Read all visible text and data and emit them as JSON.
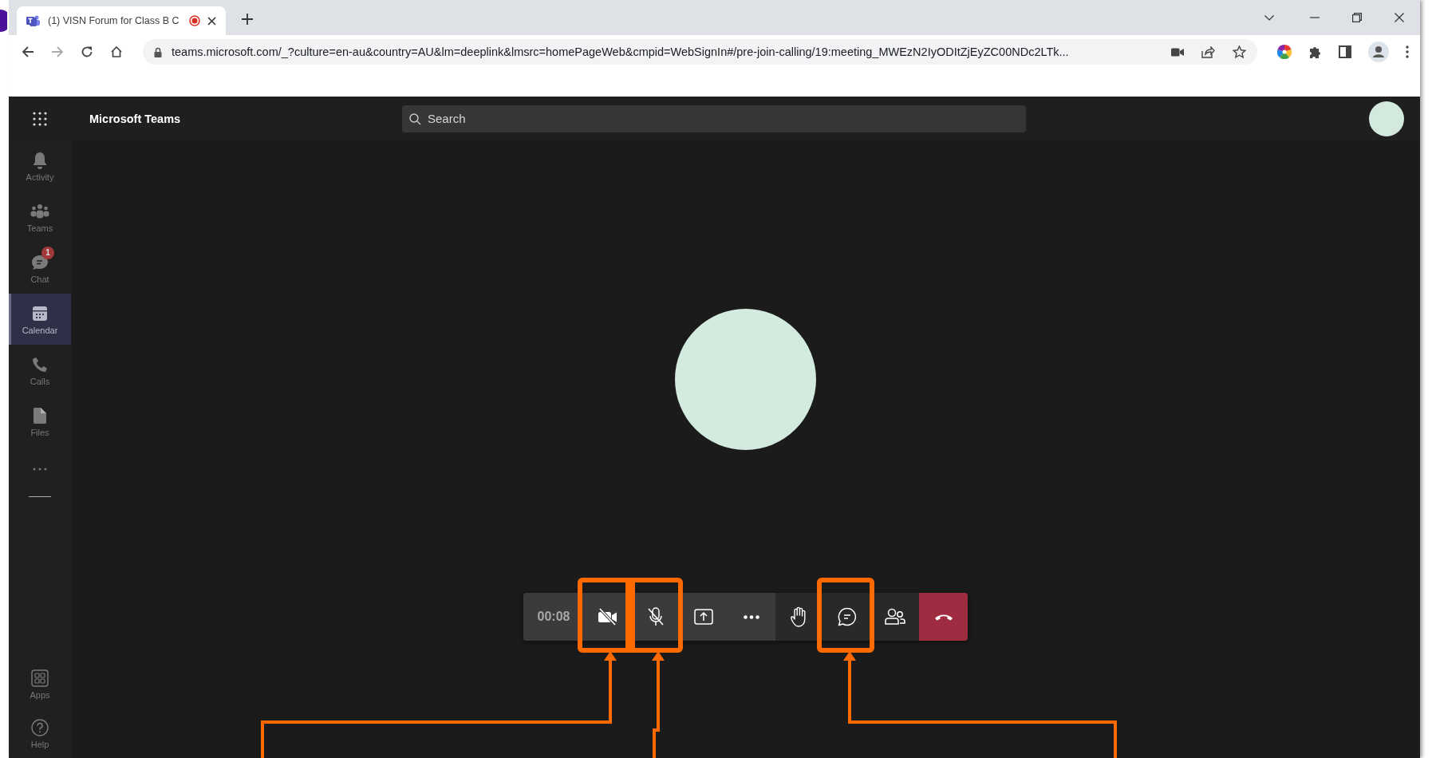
{
  "browser": {
    "tab": {
      "title": "(1) VISN Forum for Class B C",
      "recording": true
    },
    "address": "teams.microsoft.com/_?culture=en-au&country=AU&lm=deeplink&lmsrc=homePageWeb&cmpid=WebSignIn#/pre-join-calling/19:meeting_MWEzN2IyODItZjEyZC00NDc2LTk..."
  },
  "app": {
    "title": "Microsoft Teams",
    "search": {
      "placeholder": "Search"
    }
  },
  "sidebar": {
    "items": [
      {
        "kind": "activity",
        "label": "Activity",
        "selected": false
      },
      {
        "kind": "teams",
        "label": "Teams",
        "selected": false
      },
      {
        "kind": "chat",
        "label": "Chat",
        "selected": false,
        "badge": "1"
      },
      {
        "kind": "calendar",
        "label": "Calendar",
        "selected": true
      },
      {
        "kind": "calls",
        "label": "Calls",
        "selected": false
      },
      {
        "kind": "files",
        "label": "Files",
        "selected": false
      }
    ],
    "bottom_items": [
      {
        "kind": "apps",
        "label": "Apps",
        "selected": false
      },
      {
        "kind": "help",
        "label": "Help",
        "selected": false
      }
    ]
  },
  "call": {
    "timer": "00:08",
    "controls": [
      {
        "kind": "camera",
        "off": true,
        "highlighted": true
      },
      {
        "kind": "mic",
        "off": true,
        "highlighted": true
      },
      {
        "kind": "share",
        "highlighted": false
      },
      {
        "kind": "more",
        "highlighted": false
      },
      {
        "kind": "hand",
        "highlighted": false
      },
      {
        "kind": "chat",
        "highlighted": true
      },
      {
        "kind": "people",
        "highlighted": false
      },
      {
        "kind": "hangup",
        "highlighted": false
      }
    ]
  }
}
